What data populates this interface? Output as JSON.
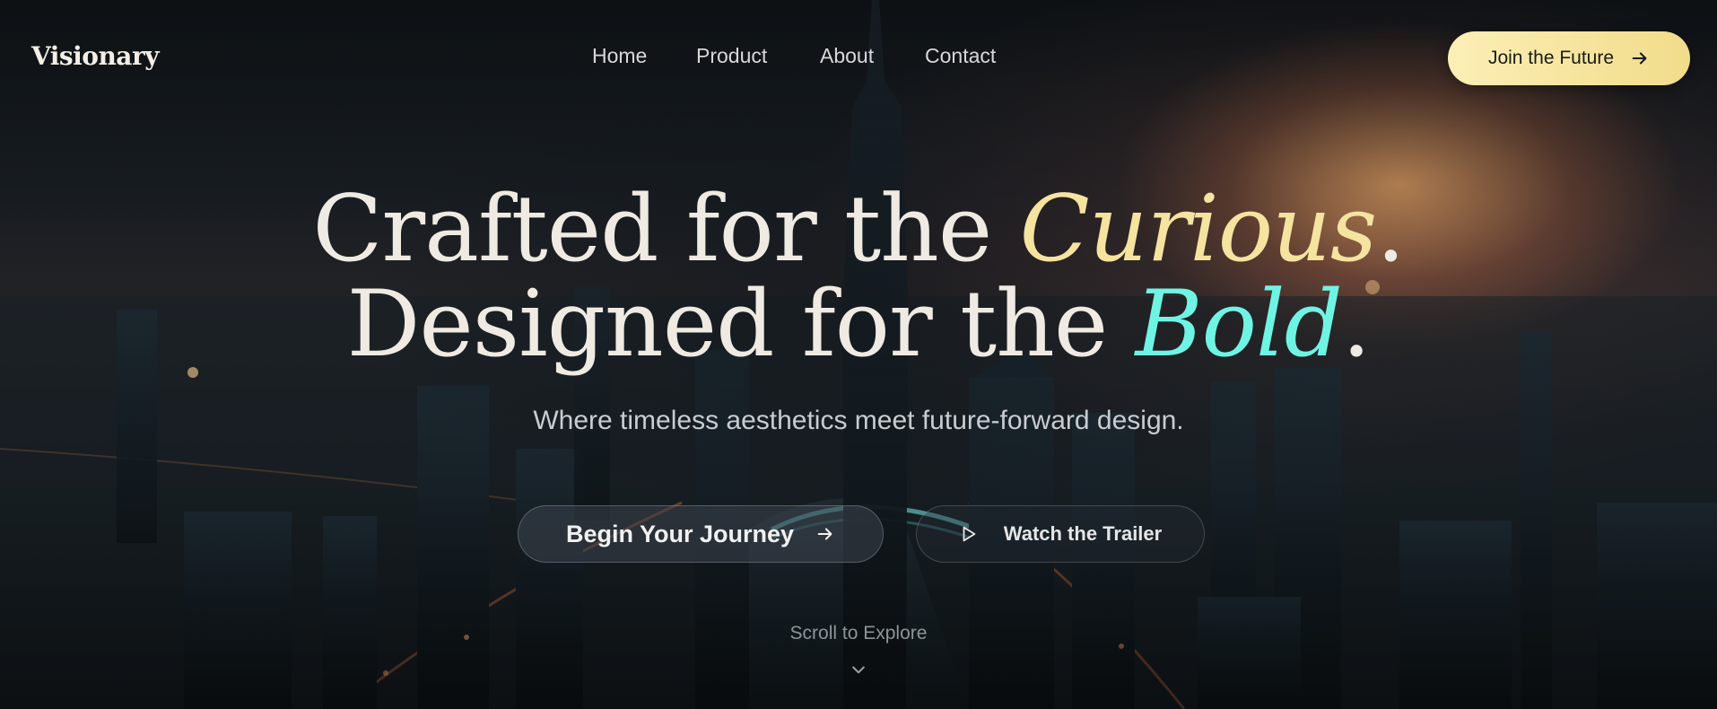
{
  "brand": {
    "logo": "Visionary"
  },
  "nav": {
    "items": [
      {
        "label": "Home"
      },
      {
        "label": "Product"
      },
      {
        "label": "About"
      },
      {
        "label": "Contact"
      }
    ],
    "cta_label": "Join the Future",
    "cta_icon": "arrow-right-icon"
  },
  "hero": {
    "line1_prefix": "Crafted for the ",
    "line1_accent": "Curious",
    "line1_suffix": ".",
    "line2_prefix": "Designed for the ",
    "line2_accent": "Bold",
    "line2_suffix": ".",
    "subtitle": "Where timeless aesthetics meet future-forward design.",
    "primary_button": {
      "label": "Begin Your Journey",
      "icon": "arrow-right-icon"
    },
    "secondary_button": {
      "label": "Watch the Trailer",
      "icon": "play-icon"
    },
    "scroll_hint": "Scroll to Explore",
    "scroll_icon": "chevron-down-icon"
  },
  "colors": {
    "accent_gold": "#f5e3a0",
    "accent_cyan": "#6ff4e4",
    "cta_background": "#f5e6a0"
  }
}
